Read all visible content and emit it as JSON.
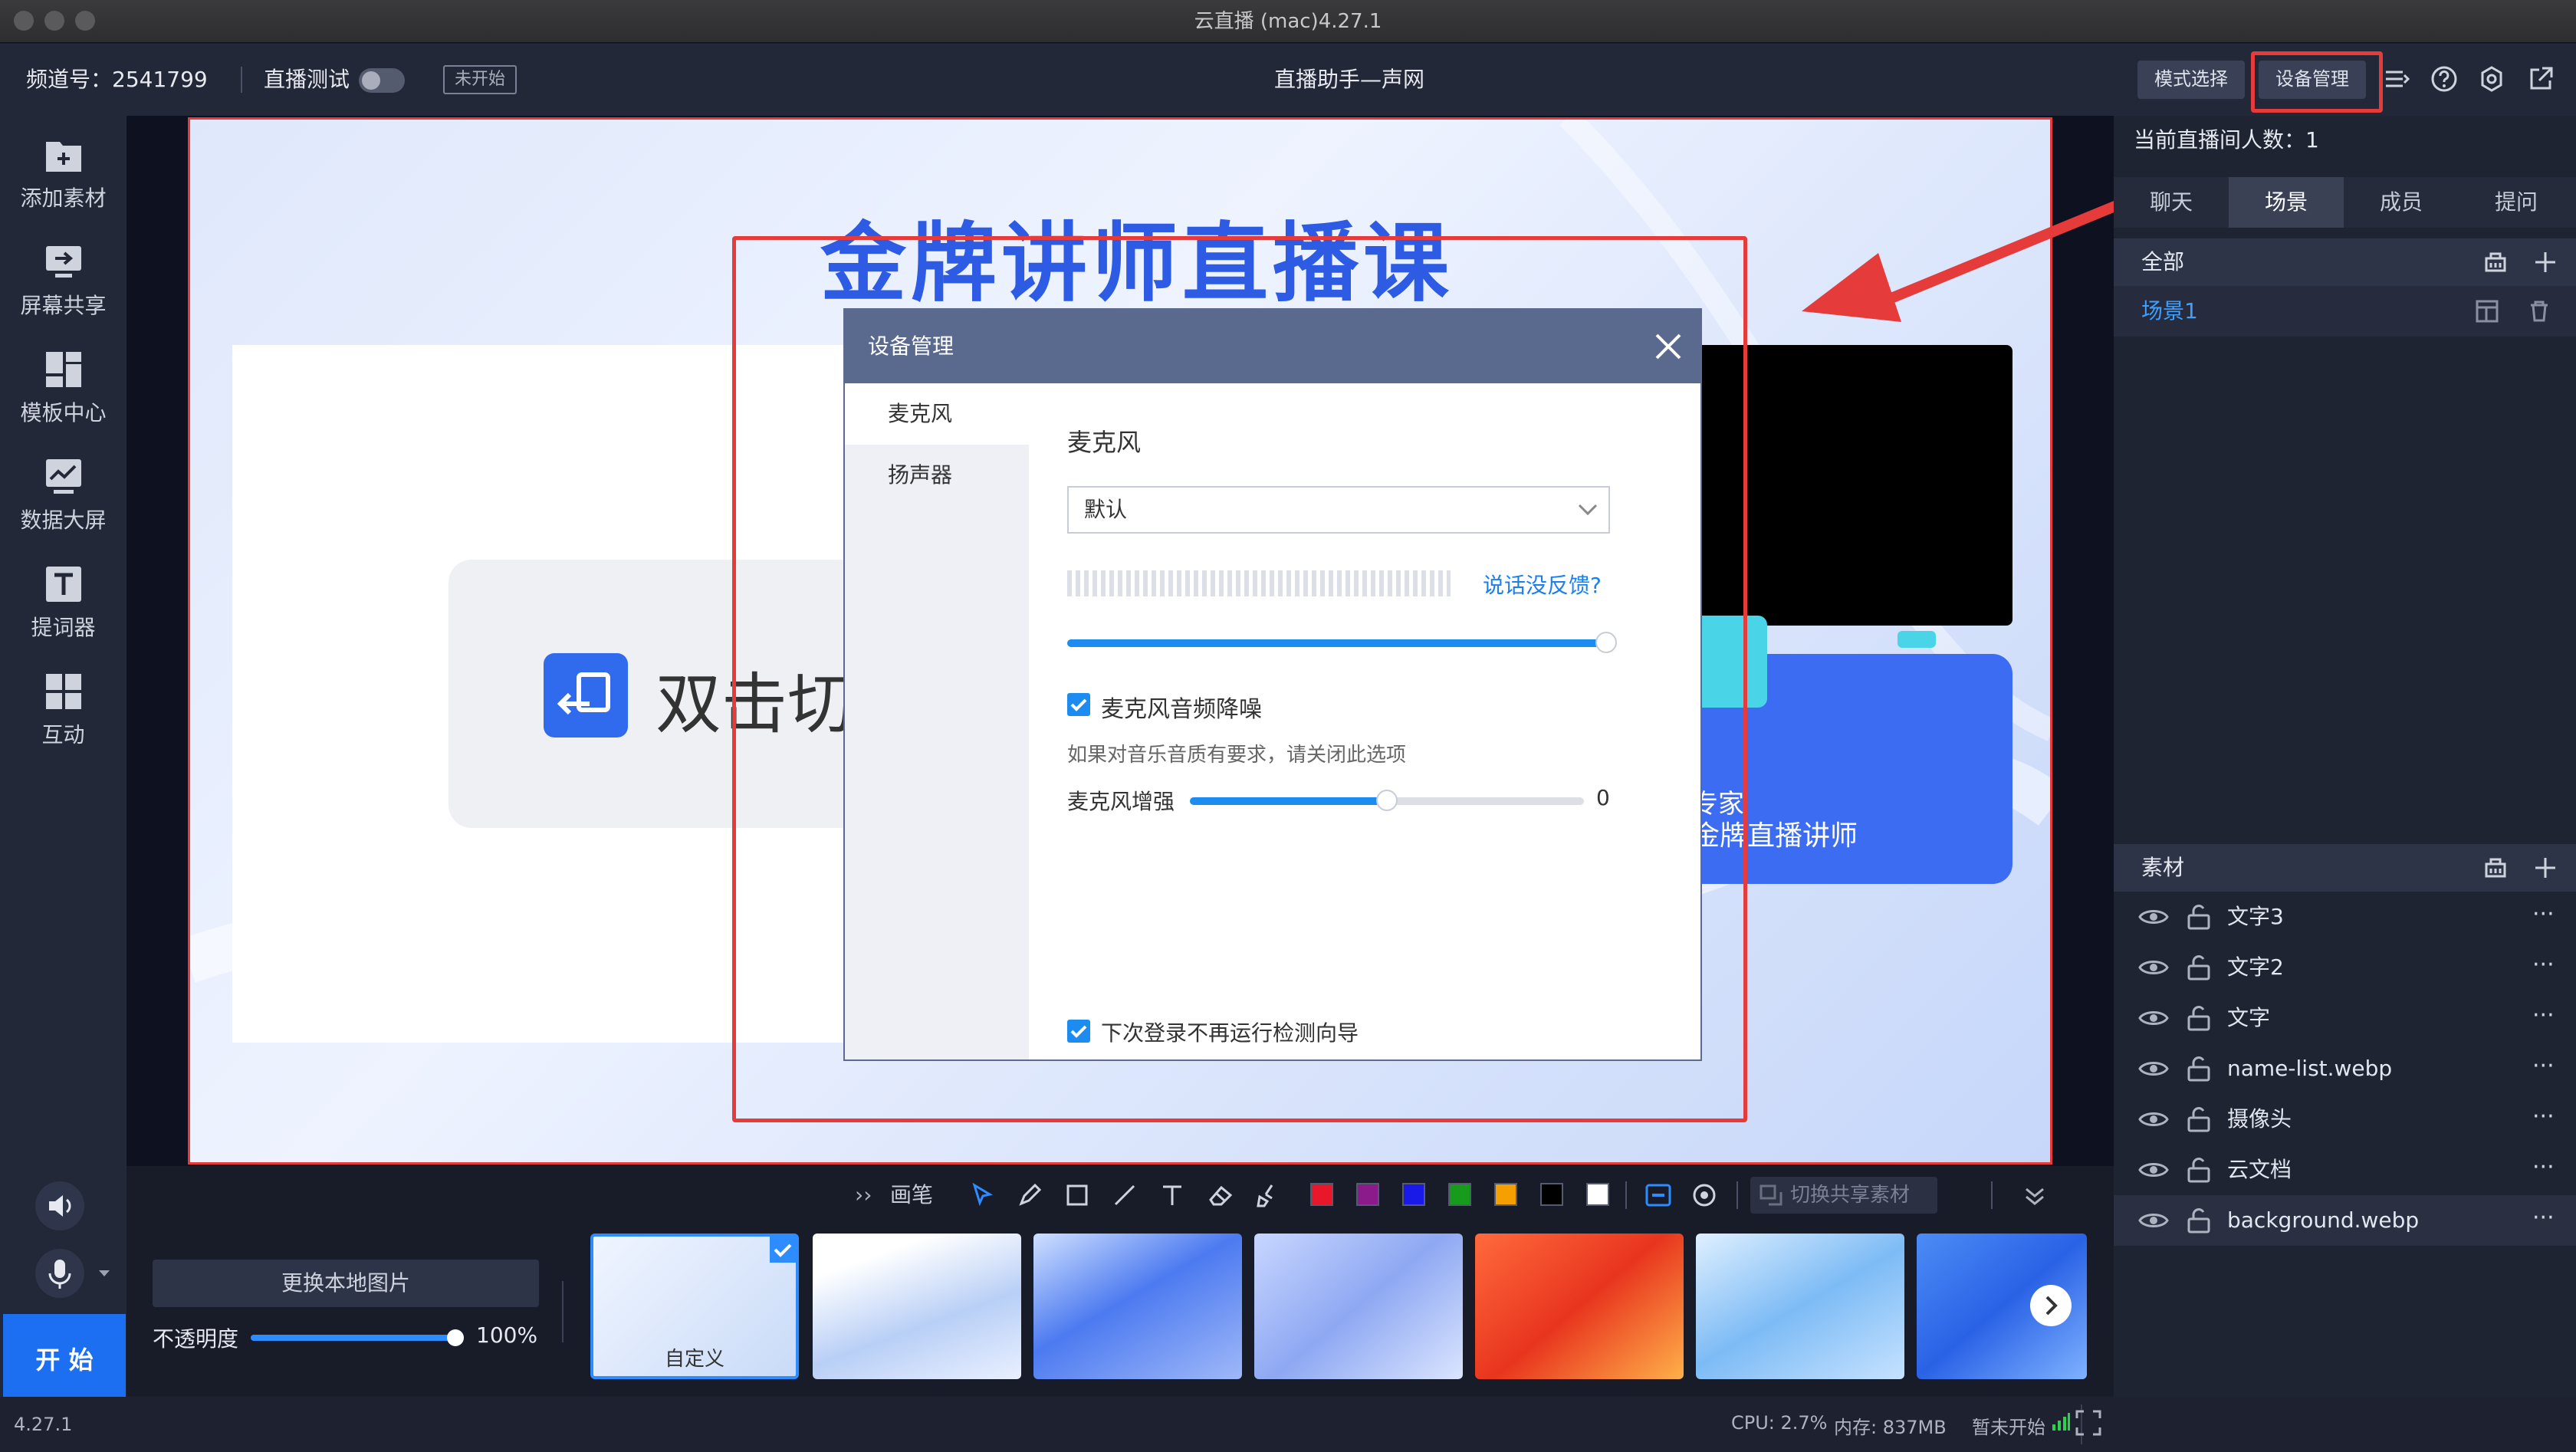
{
  "window": {
    "title": "云直播 (mac)4.27.1"
  },
  "toolbar": {
    "channel": "频道号：2541799",
    "live_test": "直播测试",
    "status_badge": "未开始",
    "center_title": "直播助手—声网",
    "mode_button": "模式选择",
    "device_button": "设备管理"
  },
  "sidebar": {
    "items": [
      {
        "label": "添加素材",
        "icon": "add-asset-icon"
      },
      {
        "label": "屏幕共享",
        "icon": "screen-share-icon"
      },
      {
        "label": "模板中心",
        "icon": "template-icon"
      },
      {
        "label": "数据大屏",
        "icon": "data-screen-icon"
      },
      {
        "label": "提词器",
        "icon": "teleprompter-icon"
      },
      {
        "label": "互动",
        "icon": "interact-icon"
      }
    ],
    "start_label": "开 始",
    "version": "4.27.1"
  },
  "canvas": {
    "course_title": "金牌讲师直播课",
    "switch_text": "双击切",
    "badge_line1": "专家",
    "badge_line2": "金牌直播讲师"
  },
  "dialog": {
    "title": "设备管理",
    "side_items": [
      "麦克风",
      "扬声器"
    ],
    "section_title": "麦克风",
    "device_select": "默认",
    "feedback_link": "说话没反馈?",
    "volume_level": 0.99,
    "noise_label": "麦克风音频降噪",
    "noise_hint": "如果对音乐音质有要求，请关闭此选项",
    "boost_label": "麦克风增强",
    "boost_value": "0",
    "boost_level": 0.5,
    "footer_checkbox": "下次登录不再运行检测向导"
  },
  "right_panel": {
    "viewers": "当前直播间人数：1",
    "tabs": [
      "聊天",
      "场景",
      "成员",
      "提问"
    ],
    "active_tab": "场景",
    "scene_header": "全部",
    "scene_item": "场景1",
    "assets_header": "素材",
    "assets": [
      "文字3",
      "文字2",
      "文字",
      "name-list.webp",
      "摄像头",
      "云文档",
      "background.webp"
    ]
  },
  "drawing_toolbar": {
    "brush_label": "画笔",
    "share_label": "切换共享素材",
    "colors": [
      "#e8182a",
      "#8b1a8b",
      "#1a1ae8",
      "#169b1c",
      "#f5a000",
      "#000000",
      "#ffffff"
    ]
  },
  "background_panel": {
    "replace_button": "更换本地图片",
    "opacity_label": "不透明度",
    "opacity_value": "100%",
    "opacity_level": 1.0,
    "custom_label": "自定义"
  },
  "status": {
    "cpu": "CPU: 2.7%",
    "memory": "内存: 837MB",
    "live_state": "暂未开始"
  }
}
